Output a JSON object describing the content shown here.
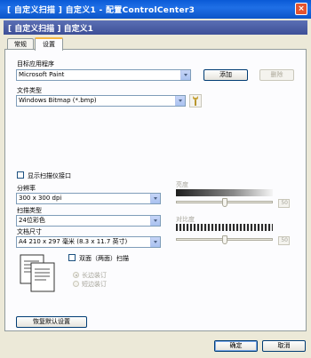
{
  "window": {
    "title": "[ 自定义扫描 ] 自定义1 - 配置ControlCenter3",
    "close_glyph": "×"
  },
  "banner": {
    "title": "[ 自定义扫描 ] 自定义1"
  },
  "tabs": [
    {
      "label": "常规",
      "active": false
    },
    {
      "label": "设置",
      "active": true
    }
  ],
  "target_app": {
    "label": "目标应用程序",
    "value": "Microsoft Paint",
    "add_label": "添加",
    "delete_label": "删除"
  },
  "file_type": {
    "label": "文件类型",
    "value": "Windows Bitmap (*.bmp)"
  },
  "scanner_ui": {
    "label": "显示扫描仪接口",
    "checked": false
  },
  "resolution": {
    "label": "分辨率",
    "value": "300 x 300 dpi"
  },
  "scan_type": {
    "label": "扫描类型",
    "value": "24位彩色"
  },
  "doc_size": {
    "label": "文档尺寸",
    "value": "A4 210 x 297 毫米 (8.3 x 11.7 英寸)"
  },
  "duplex": {
    "label": "双面（两面）扫描",
    "checked": false,
    "long_edge": "长边装订",
    "short_edge": "短边装订",
    "selected": "long_edge"
  },
  "brightness": {
    "label": "亮度",
    "value": "50",
    "level_percent": 50
  },
  "contrast": {
    "label": "对比度",
    "value": "50",
    "level_percent": 50
  },
  "restore_label": "恢复默认设置",
  "ok_label": "确定",
  "cancel_label": "取消",
  "colors": {
    "title_blue": "#0a5ad6",
    "banner": "#4a5ca6",
    "tab_accent": "#f7b741"
  }
}
